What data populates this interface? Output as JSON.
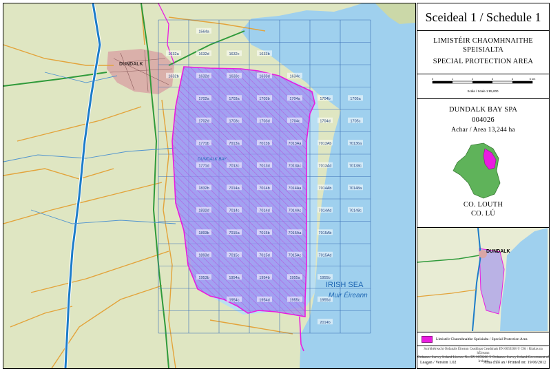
{
  "schedule_title": "Sceideal 1 / Schedule 1",
  "area_type_irish": "LIMISTÉIR CHAOMHNAITHE SPEISIALTA",
  "area_type_english": "SPECIAL PROTECTION AREA",
  "scale_bar": {
    "ticks": [
      "0",
      "1",
      "2",
      "3",
      "4",
      "5 km"
    ],
    "label": "Scála / Scale 1:85,000"
  },
  "site_name": "DUNDALK BAY SPA",
  "site_code": "004026",
  "site_area": "Achar / Area 13,244 ha",
  "county_en": "CO. LOUTH",
  "county_ga": "CO. LÚ",
  "legend_label": "Limistéir Chaomhnaithe Speisialta / Special Protection Area",
  "copyright_lines": [
    "Suirbhéireacht Ordanáis Éireann Ceadúnas Ceadúnais EN 0059208 © OSi / Rialtas na hÉireann",
    "Ordnance Survey Ireland Licence No. EN 0059208 © Ordnance Survey Ireland/Government of Ireland"
  ],
  "version": "Leagan / Version 1.02",
  "printed": "Arna chló an / Printed on: 19/06/2012",
  "map_labels": {
    "sea_en": "IRISH SEA",
    "sea_ga": "Muir Éireann",
    "town": "DUNDALK",
    "bay": "DUNDALK BAY"
  },
  "grid_labels": [
    {
      "t": "1564a",
      "r": 0,
      "c": 1
    },
    {
      "t": "1632a",
      "r": 1,
      "c": 0
    },
    {
      "t": "1632d",
      "r": 1,
      "c": 1
    },
    {
      "t": "1632c",
      "r": 1,
      "c": 2
    },
    {
      "t": "1633b",
      "r": 1,
      "c": 3
    },
    {
      "t": "1632b",
      "r": 2,
      "c": 0
    },
    {
      "t": "1632d",
      "r": 2,
      "c": 1
    },
    {
      "t": "1633c",
      "r": 2,
      "c": 2
    },
    {
      "t": "1633d",
      "r": 2,
      "c": 3
    },
    {
      "t": "1634c",
      "r": 2,
      "c": 4
    },
    {
      "t": "1702a",
      "r": 3,
      "c": 1
    },
    {
      "t": "1703a",
      "r": 3,
      "c": 2
    },
    {
      "t": "1703b",
      "r": 3,
      "c": 3
    },
    {
      "t": "1704a",
      "r": 3,
      "c": 4
    },
    {
      "t": "1704b",
      "r": 3,
      "c": 5
    },
    {
      "t": "1705a",
      "r": 3,
      "c": 6
    },
    {
      "t": "1702d",
      "r": 4,
      "c": 1
    },
    {
      "t": "1703c",
      "r": 4,
      "c": 2
    },
    {
      "t": "1703d",
      "r": 4,
      "c": 3
    },
    {
      "t": "1704c",
      "r": 4,
      "c": 4
    },
    {
      "t": "1704d",
      "r": 4,
      "c": 5
    },
    {
      "t": "1705c",
      "r": 4,
      "c": 6
    },
    {
      "t": "1771b",
      "r": 5,
      "c": 1
    },
    {
      "t": "7013a",
      "r": 5,
      "c": 2
    },
    {
      "t": "7013b",
      "r": 5,
      "c": 3
    },
    {
      "t": "7013Aa",
      "r": 5,
      "c": 4
    },
    {
      "t": "7013Ab",
      "r": 5,
      "c": 5
    },
    {
      "t": "70136a",
      "r": 5,
      "c": 6
    },
    {
      "t": "1771d",
      "r": 6,
      "c": 1
    },
    {
      "t": "7013c",
      "r": 6,
      "c": 2
    },
    {
      "t": "7013d",
      "r": 6,
      "c": 3
    },
    {
      "t": "7013Ac",
      "r": 6,
      "c": 4
    },
    {
      "t": "7013Ad",
      "r": 6,
      "c": 5
    },
    {
      "t": "70138c",
      "r": 6,
      "c": 6
    },
    {
      "t": "1832b",
      "r": 7,
      "c": 1
    },
    {
      "t": "7014a",
      "r": 7,
      "c": 2
    },
    {
      "t": "7014b",
      "r": 7,
      "c": 3
    },
    {
      "t": "7014Aa",
      "r": 7,
      "c": 4
    },
    {
      "t": "7014Ab",
      "r": 7,
      "c": 5
    },
    {
      "t": "70148a",
      "r": 7,
      "c": 6
    },
    {
      "t": "1832d",
      "r": 8,
      "c": 1
    },
    {
      "t": "7014c",
      "r": 8,
      "c": 2
    },
    {
      "t": "7014d",
      "r": 8,
      "c": 3
    },
    {
      "t": "7014Ac",
      "r": 8,
      "c": 4
    },
    {
      "t": "7014Ad",
      "r": 8,
      "c": 5
    },
    {
      "t": "70148c",
      "r": 8,
      "c": 6
    },
    {
      "t": "1893b",
      "r": 9,
      "c": 1
    },
    {
      "t": "7015a",
      "r": 9,
      "c": 2
    },
    {
      "t": "7015b",
      "r": 9,
      "c": 3
    },
    {
      "t": "7015Aa",
      "r": 9,
      "c": 4
    },
    {
      "t": "7015Ab",
      "r": 9,
      "c": 5
    },
    {
      "t": "1893d",
      "r": 10,
      "c": 1
    },
    {
      "t": "7015c",
      "r": 10,
      "c": 2
    },
    {
      "t": "7015d",
      "r": 10,
      "c": 3
    },
    {
      "t": "7015Ac",
      "r": 10,
      "c": 4
    },
    {
      "t": "7015Ad",
      "r": 10,
      "c": 5
    },
    {
      "t": "1953b",
      "r": 11,
      "c": 1
    },
    {
      "t": "1954a",
      "r": 11,
      "c": 2
    },
    {
      "t": "1954b",
      "r": 11,
      "c": 3
    },
    {
      "t": "1955a",
      "r": 11,
      "c": 4
    },
    {
      "t": "1955b",
      "r": 11,
      "c": 5
    },
    {
      "t": "1954c",
      "r": 12,
      "c": 2
    },
    {
      "t": "1954d",
      "r": 12,
      "c": 3
    },
    {
      "t": "1955c",
      "r": 12,
      "c": 4
    },
    {
      "t": "1955d",
      "r": 12,
      "c": 5
    },
    {
      "t": "2014b",
      "r": 13,
      "c": 5
    }
  ],
  "colors": {
    "spa_fill": "#9b8cf0",
    "spa_outline": "#e91ce0",
    "sea": "#9fd0ee",
    "land": "#dfe6c2",
    "grid": "#3a6fb5",
    "motorway": "#1c7cc9",
    "road_a": "#2f9a3a",
    "road_b": "#e3a33a",
    "town": "#d9a6a6"
  }
}
